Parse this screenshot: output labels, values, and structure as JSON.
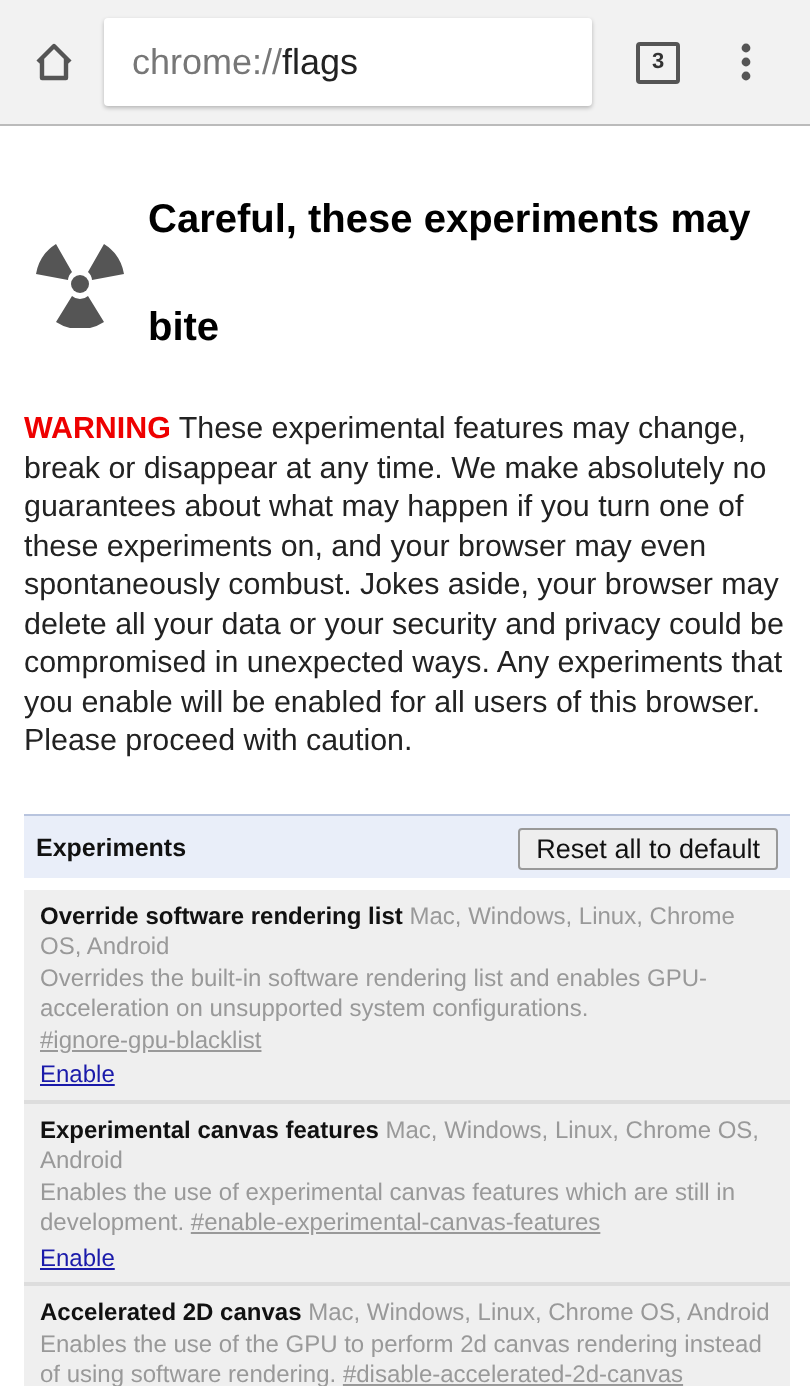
{
  "toolbar": {
    "url_scheme": "chrome://",
    "url_path": "flags",
    "tab_count": "3"
  },
  "heading": "Careful, these experiments may bite",
  "warning": {
    "label": "WARNING",
    "text": "These experimental features may change, break or disappear at any time. We make absolutely no guarantees about what may happen if you turn one of these experiments on, and your browser may even spontaneously combust. Jokes aside, your browser may delete all your data or your security and privacy could be compromised in unexpected ways. Any experiments that you enable will be enabled for all users of this browser. Please proceed with caution."
  },
  "experiments": {
    "title": "Experiments",
    "reset_button": "Reset all to default",
    "items": [
      {
        "name": "Override software rendering list",
        "platforms": "Mac, Windows, Linux, Chrome OS, Android",
        "description": "Overrides the built-in software rendering list and enables GPU-acceleration on unsupported system configurations.",
        "flag": "#ignore-gpu-blacklist",
        "action": "Enable"
      },
      {
        "name": "Experimental canvas features",
        "platforms": "Mac, Windows, Linux, Chrome OS, Android",
        "description": "Enables the use of experimental canvas features which are still in development.",
        "flag": "#enable-experimental-canvas-features",
        "action": "Enable"
      },
      {
        "name": "Accelerated 2D canvas",
        "platforms": "Mac, Windows, Linux, Chrome OS, Android",
        "description": "Enables the use of the GPU to perform 2d canvas rendering instead of using software rendering.",
        "flag": "#disable-accelerated-2d-canvas"
      }
    ]
  }
}
